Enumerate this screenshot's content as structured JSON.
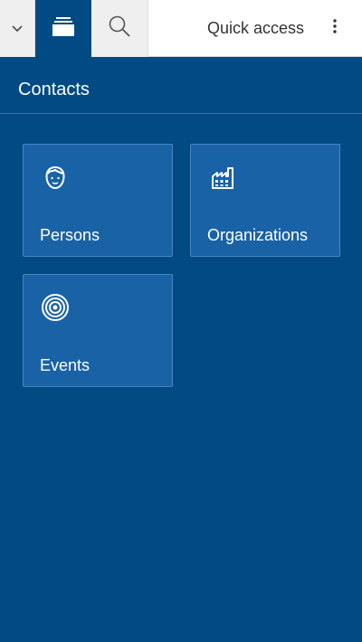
{
  "topbar": {
    "dropdown_icon": "chevron-down-icon",
    "desktop_icon": "desktop-stack-icon",
    "search_icon": "search-icon",
    "quick_access_label": "Quick access",
    "more_icon": "more-vertical-icon"
  },
  "header": {
    "title": "Contacts"
  },
  "tiles": [
    {
      "label": "Persons",
      "icon": "person-icon"
    },
    {
      "label": "Organizations",
      "icon": "factory-icon"
    },
    {
      "label": "Events",
      "icon": "target-icon"
    }
  ],
  "colors": {
    "background": "#014a84",
    "tile": "#1962a6",
    "tile_border": "#4a86c0",
    "topbar": "#ffffff",
    "topbar_button": "#efefef",
    "text_light": "#ffffff",
    "text_dark": "#333333"
  }
}
